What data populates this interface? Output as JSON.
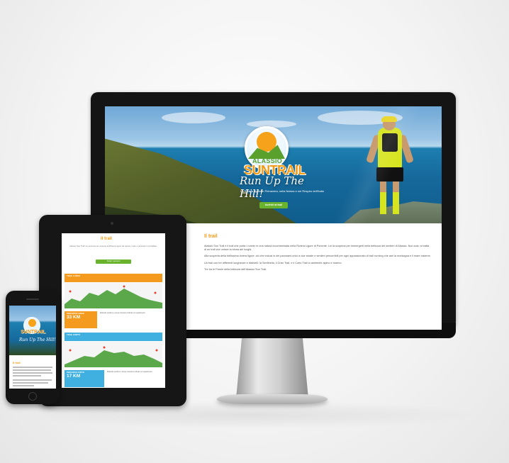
{
  "site": {
    "logo_line1": "ALASSIO",
    "logo_line2": "SUNTRAIL",
    "tagline": "Run Up The Hill!",
    "subtitle": "La Riviera ligure in Primavera, nella Natura e nel Respiro dell'Italia",
    "cta_label": "Iscriviti al trail",
    "colors": {
      "orange": "#f29a16",
      "green": "#6ab42d",
      "blue": "#3fb0e0"
    }
  },
  "desktop": {
    "section_title": "Il trail",
    "paragraphs": [
      "Alassio Sun Trail è il trail che porta i runner in una natura incontaminata nella Riviera Ligure di Ponente. Lei la scoprirai per immergerti nella bellezza dei sentieri di Alassio. Non solo: si tratta di un trail che unisce la storia dei luoghi.",
      "Alla scoperta della bellissima riviera ligure: ciò che inclusi in dei panorami unici a due strade e sentieri percorribili per ogni appassionato di trail running che ami la montagna e il mare insieme.",
      "Un trail con tre differenti lunghezze e dislivelli: la Sentinella, il Gran Trail, e il Corto Trail in ambiente alpino e marino.",
      "Tre tra le Parole della bellezza dell'Alassio Sun Trail."
    ]
  },
  "tablet": {
    "title": "Il trail",
    "intro": "Alassio Sun Trail: tre percorsi per scoprire la Riviera Ligure tra natura, mare e panorami mozzafiato.",
    "button": "Scopri i percorsi",
    "route1_header": "TRAIL LUNGO",
    "route1_stat_label": "PERCORSO LUNGO",
    "route1_stat_value": "33 KM",
    "route1_info": "Dislivello positivo e tempo massimo indicati nel regolamento.",
    "route2_header": "TRAIL CORTO",
    "route2_stat_label": "PERCORSO CORTO",
    "route2_stat_value": "17 KM",
    "route2_info": "Dislivello positivo e tempo massimo indicati nel regolamento."
  },
  "phone": {
    "logo": "SUNTRAIL",
    "tagline": "Run Up The Hill!",
    "section_title": "Il trail"
  }
}
